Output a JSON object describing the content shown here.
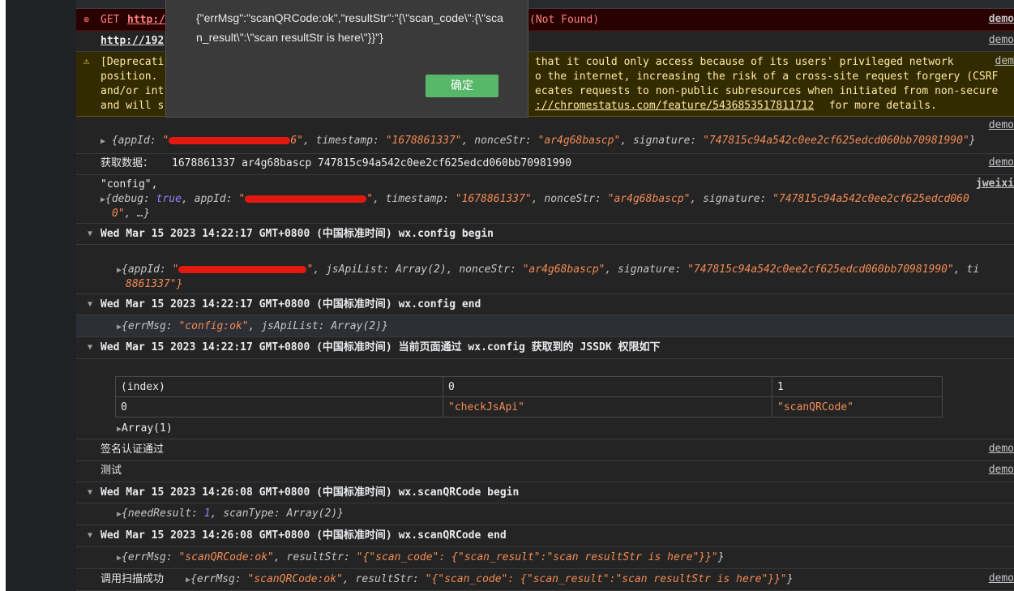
{
  "error_row": {
    "method": "GET",
    "url": "http://",
    "status": "(Not Found)",
    "source": "demo",
    "url2": "http://192",
    "source2": "demo"
  },
  "warning_row": {
    "line1a": "[Deprecati",
    "line1b": "that it could only access because of its users' privileged network",
    "line2a": "position.",
    "line2b": "o the internet, increasing the risk of a cross-site request forgery (CSRF",
    "line3a": "and/or int",
    "line3b": "ecates requests to non-public subresources when initiated from non-secure",
    "line4a": "and will s",
    "line4link": "://chromestatus.com/feature/5436853517811712",
    "line4c": " for more details.",
    "source": "dem"
  },
  "row_sig": {
    "source": "demo",
    "appid_end": "6",
    "timestamp": "\"1678861337\"",
    "nonce": "\"ar4g68bascp\"",
    "signature": "\"747815c94a542c0ee2cf625edcd060bb70981990\""
  },
  "row_fetch": {
    "label": "获取数据：",
    "text": "1678861337 ar4g68bascp 747815c94a542c0ee2cf625edcd060bb70981990",
    "source": "demo"
  },
  "row_config": {
    "label": "\"config\",",
    "source": "jweixi",
    "debug": "true",
    "timestamp": "\"1678861337\"",
    "nonce": "\"ar4g68bascp\"",
    "signature": "\"747815c94a542c0ee2cf625edcd060",
    "wrap": "0\"",
    "tail": ", …}"
  },
  "groups": {
    "config_begin": "Wed Mar 15 2023 14:22:17 GMT+0800 (中国标准时间) wx.config begin",
    "config_end": "Wed Mar 15 2023 14:22:17 GMT+0800 (中国标准时间) wx.config end",
    "jssdk": "Wed Mar 15 2023 14:22:17 GMT+0800 (中国标准时间) 当前页面通过 wx.config 获取到的 JSSDK 权限如下",
    "scan_begin": "Wed Mar 15 2023 14:26:08 GMT+0800 (中国标准时间) wx.scanQRCode begin",
    "scan_end": "Wed Mar 15 2023 14:26:08 GMT+0800 (中国标准时间) wx.scanQRCode end"
  },
  "config_begin_obj": {
    "jsApiList": "Array(2)",
    "nonce": "\"ar4g68bascp\"",
    "signature": "\"747815c94a542c0ee2cf625edcd060bb70981990\"",
    "ti": ", ti",
    "wrap": "8861337\"}"
  },
  "config_end_obj": {
    "errMsg": "\"config:ok\"",
    "jsApiList": "Array(2)"
  },
  "table": {
    "headers": [
      "(index)",
      "0",
      "1"
    ],
    "row": [
      "0",
      "\"checkJsApi\"",
      "\"scanQRCode\""
    ],
    "array": "Array(1)"
  },
  "row_sign_ok": {
    "text": "签名认证通过",
    "source": "demo"
  },
  "row_test": {
    "text": "测试",
    "source": "demo"
  },
  "scan_begin_obj": {
    "needResult": "1",
    "scanType": "Array(2)"
  },
  "scan_end_obj": {
    "errMsg": "\"scanQRCode:ok\"",
    "resultStr": "\"{\"scan_code\": {\"scan_result\":\"scan resultStr is here\"}}\""
  },
  "row_call_ok": {
    "label": "调用扫描成功",
    "errMsg": "\"scanQRCode:ok\"",
    "resultStr": "\"{\"scan_code\": {\"scan_result\":\"scan resultStr is here\"}}\"",
    "source": "demo"
  },
  "dialog": {
    "message": "{\"errMsg\":\"scanQRCode:ok\",\"resultStr\":\"{\\\"scan_code\\\":{\\\"scan_result\\\":\\\"scan resultStr is here\\\"}}\"}",
    "ok_label": "确定"
  }
}
